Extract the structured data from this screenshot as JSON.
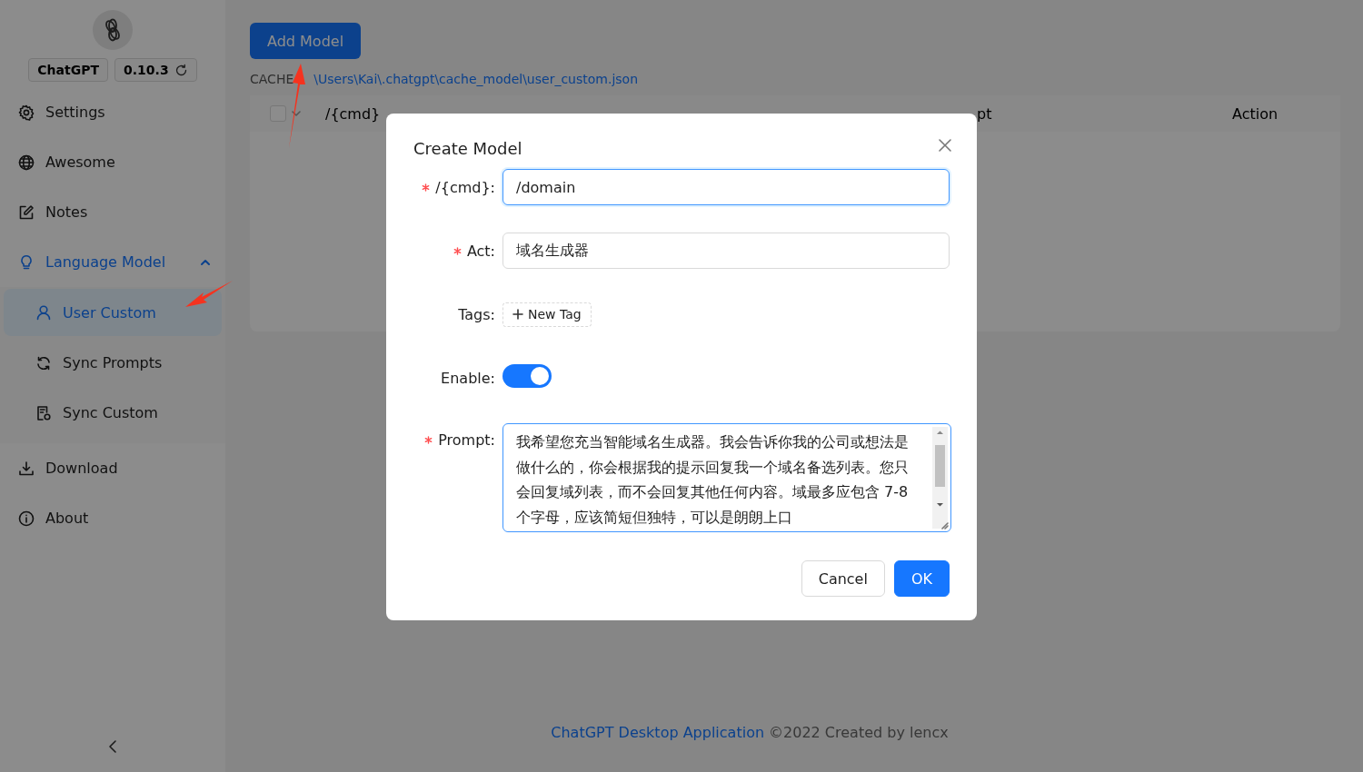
{
  "sidebar": {
    "app_name": "ChatGPT",
    "version": "0.10.3",
    "items": [
      {
        "label": "Settings",
        "selected": false
      },
      {
        "label": "Awesome",
        "selected": false
      },
      {
        "label": "Notes",
        "selected": false
      },
      {
        "label": "Language Model",
        "selected": false,
        "expanded": true,
        "children": [
          {
            "label": "User Custom",
            "selected": true
          },
          {
            "label": "Sync Prompts",
            "selected": false
          },
          {
            "label": "Sync Custom",
            "selected": false
          }
        ]
      },
      {
        "label": "Download",
        "selected": false
      },
      {
        "label": "About",
        "selected": false
      }
    ]
  },
  "toolbar": {
    "add_button": "Add Model",
    "cache_label": "CACHE",
    "cache_path": "\\Users\\Kai\\.chatgpt\\cache_model\\user_custom.json"
  },
  "table": {
    "select_all_checked": false,
    "columns": [
      "/{cmd}",
      "pt",
      "Action"
    ]
  },
  "dialog": {
    "title": "Create Model",
    "fields": [
      {
        "kind": "text",
        "label": "/{cmd}:",
        "required": true,
        "value": "/domain",
        "focused": true
      },
      {
        "kind": "text",
        "label": "Act:",
        "required": true,
        "value": "域名生成器",
        "focused": false
      },
      {
        "kind": "tags",
        "label": "Tags:",
        "required": false,
        "add_label": "New Tag"
      },
      {
        "kind": "switch",
        "label": "Enable:",
        "required": false,
        "on": true
      },
      {
        "kind": "textarea",
        "label": "Prompt:",
        "required": true,
        "value": "我希望您充当智能域名生成器。我会告诉你我的公司或想法是做什么的，你会根据我的提示回复我一个域名备选列表。您只会回复域列表，而不会回复其他任何内容。域最多应包含 7-8 个字母，应该简短但独特，可以是朗朗上口"
      }
    ],
    "buttons": [
      {
        "label": "Cancel",
        "primary": false
      },
      {
        "label": "OK",
        "primary": true
      }
    ]
  },
  "footer": {
    "link": "ChatGPT Desktop Application",
    "text": "©2022 Created by lencx"
  }
}
